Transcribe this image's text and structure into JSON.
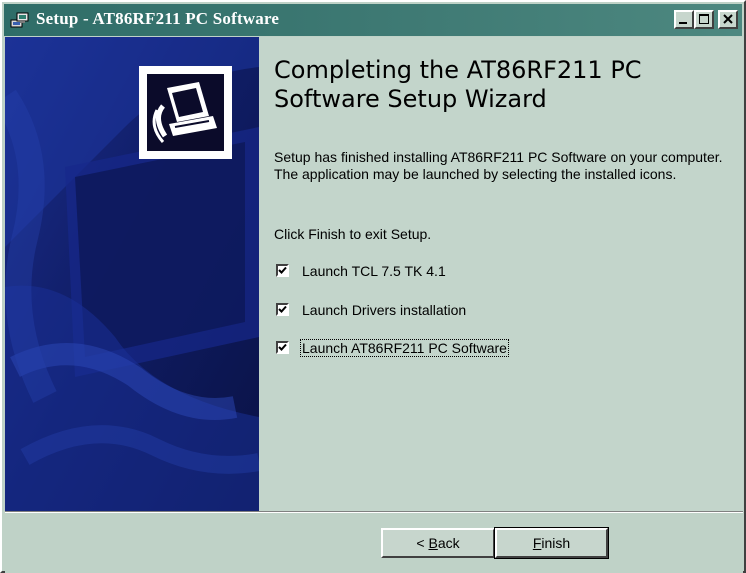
{
  "window": {
    "title": "Setup - AT86RF211 PC Software",
    "buttons": [
      "minimize",
      "maximize",
      "close"
    ]
  },
  "colors": {
    "titlebar": "#2f6d68",
    "sidebar": "#101a56",
    "dialog_bg": "#c3d5cb"
  },
  "icons": {
    "title": "setup-computer-icon",
    "wizard": "wizard-computer-icon"
  },
  "content": {
    "heading": "Completing the AT86RF211 PC Software Setup Wizard",
    "paragraph": "Setup has finished installing AT86RF211 PC Software on your computer. The application may be launched by selecting the installed icons.",
    "finish_hint": "Click Finish to exit Setup."
  },
  "checkboxes": [
    {
      "label": "Launch TCL 7.5 TK 4.1",
      "checked": true
    },
    {
      "label": "Launch Drivers installation",
      "checked": true
    },
    {
      "label": "Launch AT86RF211 PC Software",
      "checked": true
    }
  ],
  "footer": {
    "back": {
      "pre": "< ",
      "key": "B",
      "rest": "ack"
    },
    "finish": {
      "key": "F",
      "rest": "inish"
    }
  }
}
